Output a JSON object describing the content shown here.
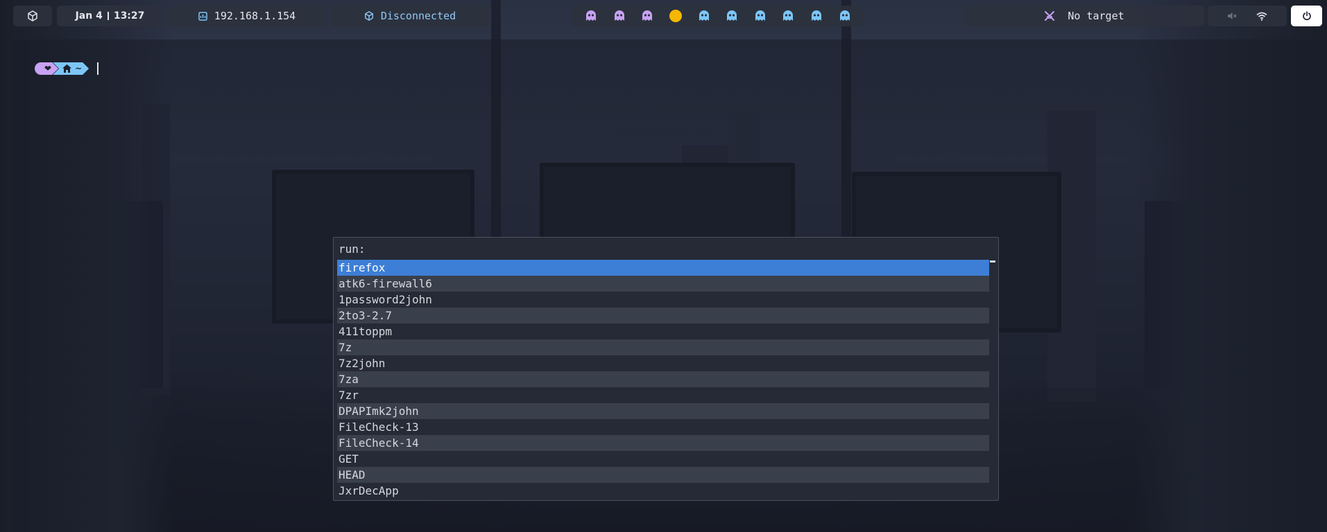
{
  "topbar": {
    "logo_icon": "cube-icon",
    "date": "Jan 4",
    "time": "13:27",
    "ip_icon": "network-card-icon",
    "ip": "192.168.1.154",
    "vpn_icon": "vpn-cube-icon",
    "vpn_status": "Disconnected",
    "workspaces": [
      {
        "icon": "ghost-icon",
        "color": "#c8a2f3"
      },
      {
        "icon": "ghost-icon",
        "color": "#c8a2f3"
      },
      {
        "icon": "ghost-icon",
        "color": "#c8a2f3"
      },
      {
        "icon": "pacman-dot-icon",
        "color": "#f5b800",
        "active": true
      },
      {
        "icon": "ghost-icon",
        "color": "#7cc6f7"
      },
      {
        "icon": "ghost-icon",
        "color": "#7cc6f7"
      },
      {
        "icon": "ghost-icon",
        "color": "#7cc6f7"
      },
      {
        "icon": "ghost-icon",
        "color": "#7cc6f7"
      },
      {
        "icon": "ghost-icon",
        "color": "#7cc6f7"
      },
      {
        "icon": "ghost-icon",
        "color": "#7cc6f7"
      }
    ],
    "target_icon": "crossed-swords-icon",
    "target": "No target",
    "volume_icon": "volume-muted-icon",
    "wifi_icon": "wifi-icon",
    "power_icon": "power-icon",
    "accent_purple": "#c8a2f3",
    "accent_blue": "#7cc6f7"
  },
  "terminal": {
    "prompt_heart": "❤",
    "prompt_home_icon": "home-icon",
    "prompt_path": "~"
  },
  "run_dialog": {
    "prompt": "run:",
    "selected_index": 0,
    "items": [
      "firefox",
      "atk6-firewall6",
      "1password2john",
      "2to3-2.7",
      "411toppm",
      "7z",
      "7z2john",
      "7za",
      "7zr",
      "DPAPImk2john",
      "FileCheck-13",
      "FileCheck-14",
      "GET",
      "HEAD",
      "JxrDecApp"
    ]
  }
}
